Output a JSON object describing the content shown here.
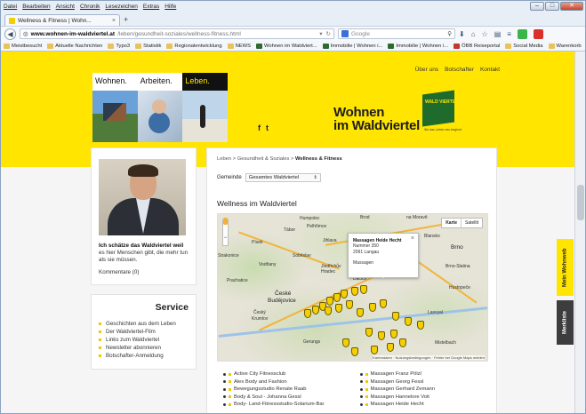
{
  "window": {
    "menu": [
      "Datei",
      "Bearbeiten",
      "Ansicht",
      "Chronik",
      "Lesezeichen",
      "Extras",
      "Hilfe"
    ],
    "controls": {
      "minimize": "–",
      "maximize": "□",
      "close": "✕"
    }
  },
  "tab": {
    "title": "Wellness & Fitness | Wohn...",
    "close": "×",
    "new": "+"
  },
  "navbar": {
    "url_host": "www.wohnen-im-waldviertel.at",
    "url_rest": "/leben/gesundheit-soziales/wellness-fitness.html",
    "search_placeholder": "Google"
  },
  "bookmarks": [
    "Meistbesucht",
    "Aktuelle Nachrichten",
    "Typo3",
    "Statistik",
    "Regionalentwicklung",
    "NEWS",
    "Wohnen im Waldviert...",
    "Immobilie | Wohnen i...",
    "Immobilie | Wohnen i...",
    "ÖBB Reiseportal",
    "Social Media",
    "Warenkorb"
  ],
  "site": {
    "topnav": [
      "Über uns",
      "Botschafter",
      "Kontakt"
    ],
    "hero_labels": [
      "Wohnen.",
      "Arbeiten.",
      "Leben."
    ],
    "social": [
      "f",
      "t"
    ],
    "logo_line1": "Wohnen",
    "logo_line2": "im Waldviertel",
    "logo_badge": "WALD VIERTEL",
    "logo_tag": "Wo das Leben neu beginnt"
  },
  "sidebar": {
    "quote_bold": "Ich schätze das Waldviertel weil",
    "quote_rest": " es hier Menschen gibt, die mehr tun als sie müssen.",
    "comments": "Kommentare (0)",
    "service_title": "Service",
    "service_items": [
      "Geschichten aus dem Leben",
      "Der Waldviertel-Film",
      "Links zum Waldviertel",
      "Newsletter abonnieren",
      "Botschafter-Anmeldung"
    ]
  },
  "content": {
    "breadcrumb_prefix": "Leben > Gesundheit & Soziales > ",
    "breadcrumb_current": "Wellness & Fitness",
    "gemeinde_label": "Gemeinde",
    "gemeinde_value": "Gesamtes Waldviertel",
    "heading": "Wellness im Waldviertel",
    "map": {
      "types": [
        "Karte",
        "Satellit"
      ],
      "popup_title": "Massagen Heide Hecht",
      "popup_lines": [
        "Nummer 350",
        "2091 Langau",
        "",
        "Massagen"
      ],
      "popup_close": "×",
      "labels": {
        "humpolec": "Humpolec",
        "brod": "Brod",
        "moravce": "na Moravě",
        "tabor": "Tábor",
        "pelhrimov": "Pelhřimov",
        "blansko": "Blansko",
        "pisek": "Písek",
        "jihlava": "Jihlava",
        "strakonice": "Strakonice",
        "brno": "Brno",
        "vodnany": "Vodňany",
        "sobeslav": "Soběslav",
        "jindrichuv": "Jindřichův Hradec",
        "brnoslatina": "Brno-Slatina",
        "prachatice": "Prachatice",
        "dacice": "Dačice",
        "hustopece": "Hustopeče",
        "budejovice1": "České",
        "budejovice2": "Budějovice",
        "krumlov1": "Český",
        "krumlov2": "Krumlov",
        "mistelbach": "Mistelbach",
        "gerungs": "Gerungs",
        "lasvyal": "Lasvyal"
      },
      "attribution": "Kartendaten · Nutzungsbedingungen · Fehler bei Google Maps melden",
      "zoom_in": "+",
      "zoom_out": "−"
    },
    "list_left": [
      "Active City Fitnessclub",
      "Alex Body and Fashion",
      "Bewegungsstudio Renate Raab",
      "Body & Soul - Johanna Gessl",
      "Body- Land-Fitnessstudio-Solarium-Bar"
    ],
    "list_right": [
      "Massagen Franz Pölzl",
      "Massagen Georg Fessl",
      "Massagen Gerhard Zemann",
      "Massagen Hannelore Voit",
      "Massagen Heide Hecht"
    ]
  },
  "sidetabs": {
    "merkzettel_top": "Mein Wohnweb",
    "merkzettel_bottom": "Merkliste"
  },
  "colors": {
    "brand_yellow": "#ffe500",
    "brand_green": "#1f6b2b"
  }
}
